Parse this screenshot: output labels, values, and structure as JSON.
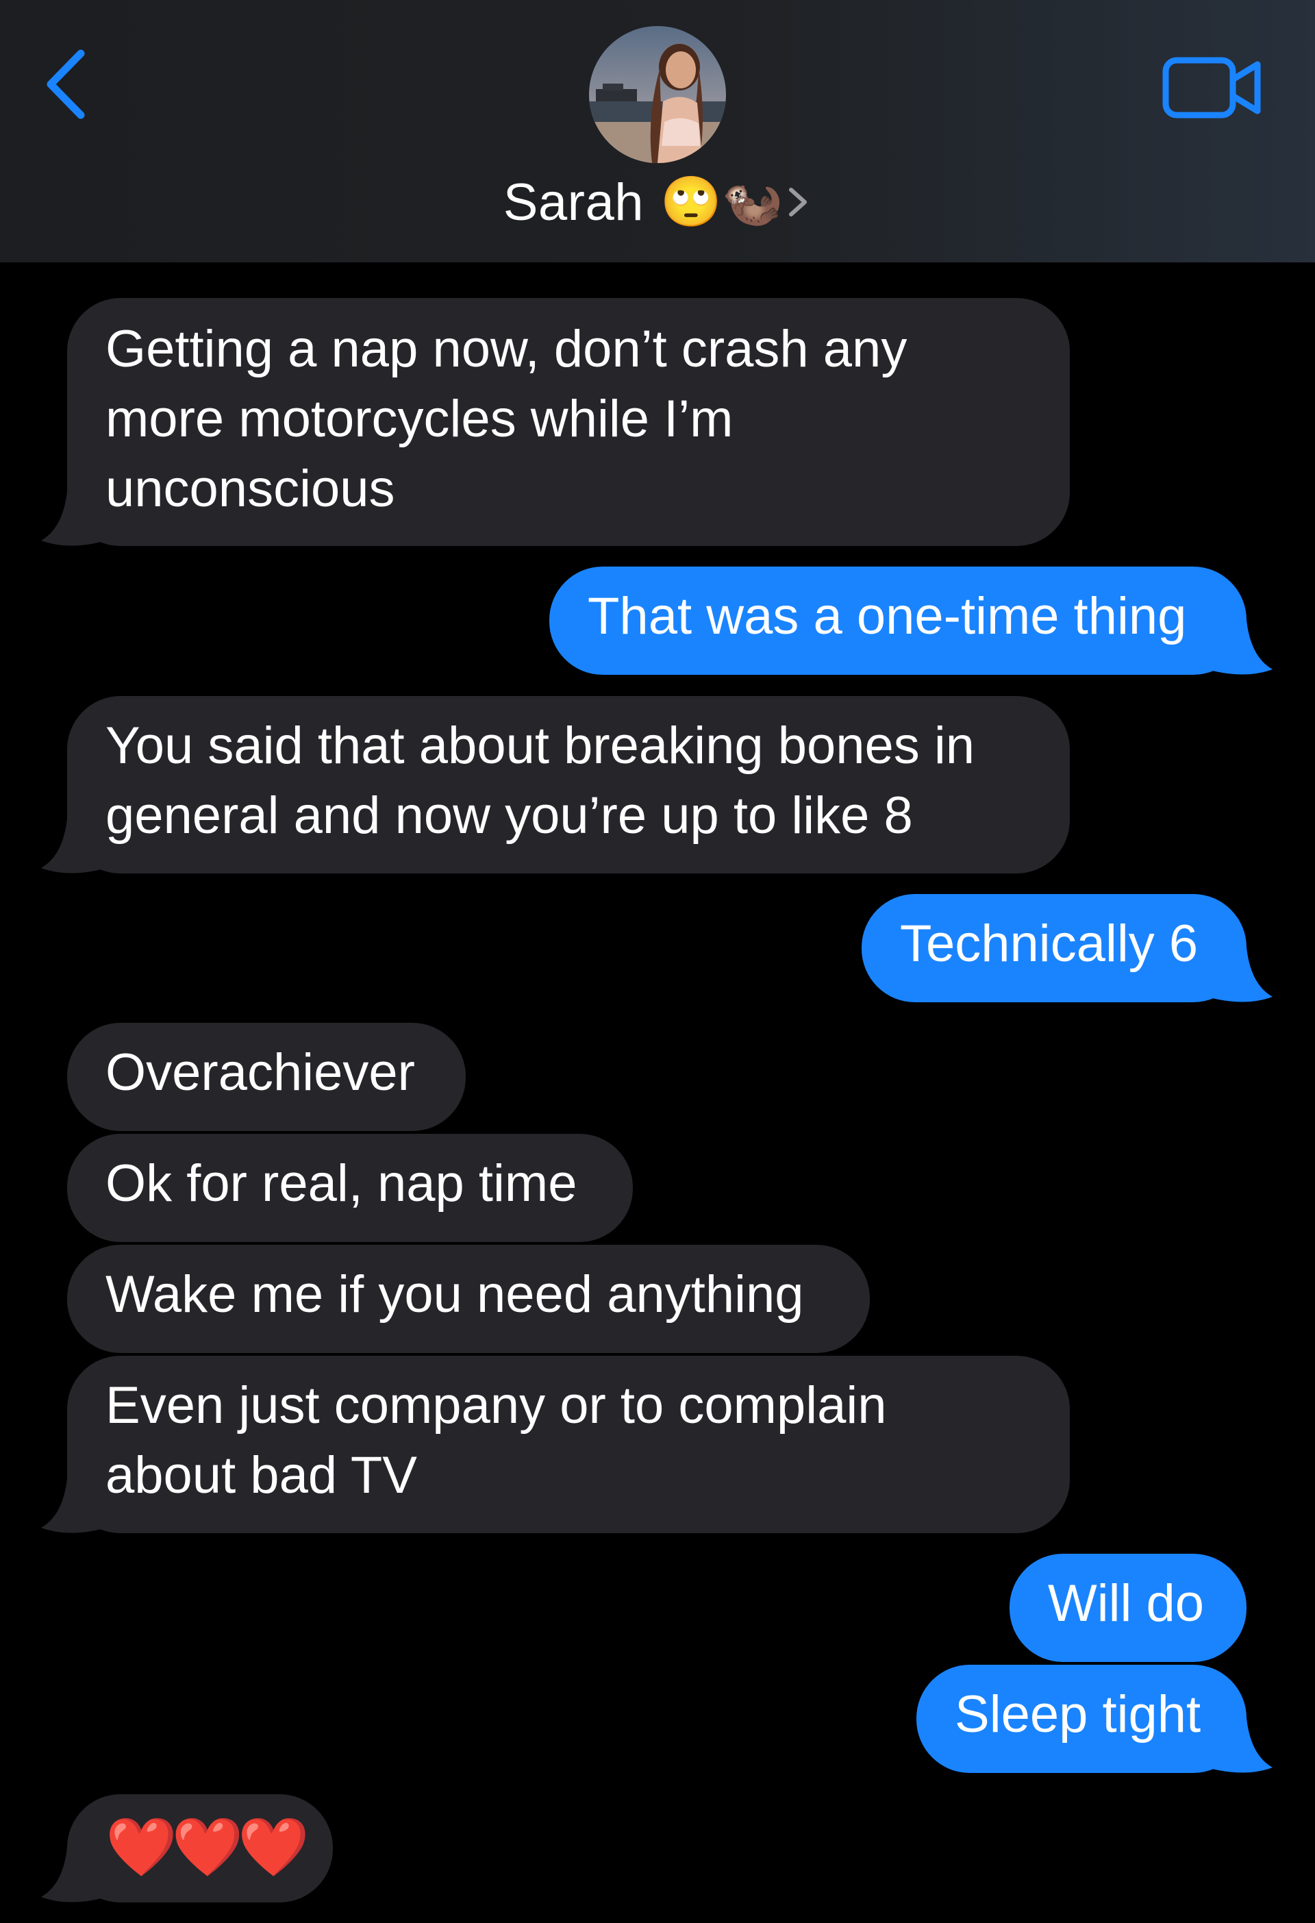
{
  "header": {
    "contact_name": "Sarah",
    "contact_emoji": "🙄🦦"
  },
  "colors": {
    "incoming_bubble": "#26252a",
    "outgoing_bubble": "#1a84ff",
    "accent": "#1a84ff",
    "background": "#000000"
  },
  "icons": {
    "back": "chevron-left-icon",
    "video": "video-camera-icon",
    "details": "chevron-right-icon"
  },
  "messages": [
    {
      "direction": "incoming",
      "text_lines": [
        "Getting a nap now, don’t crash any",
        "more motorcycles while I’m",
        "unconscious"
      ]
    },
    {
      "direction": "outgoing",
      "text": "That was a one-time thing"
    },
    {
      "direction": "incoming",
      "text_lines": [
        "You said that about breaking bones in",
        "general and now you’re up to like 8"
      ]
    },
    {
      "direction": "outgoing",
      "text": "Technically 6"
    },
    {
      "direction": "incoming",
      "text": "Overachiever"
    },
    {
      "direction": "incoming",
      "text": "Ok for real, nap time"
    },
    {
      "direction": "incoming",
      "text": "Wake me if you need anything"
    },
    {
      "direction": "incoming",
      "text_lines": [
        "Even just company or to complain",
        "about bad TV"
      ]
    },
    {
      "direction": "outgoing",
      "text": "Will do"
    },
    {
      "direction": "outgoing",
      "text": "Sleep tight"
    },
    {
      "direction": "incoming",
      "text": "❤️❤️❤️"
    }
  ]
}
